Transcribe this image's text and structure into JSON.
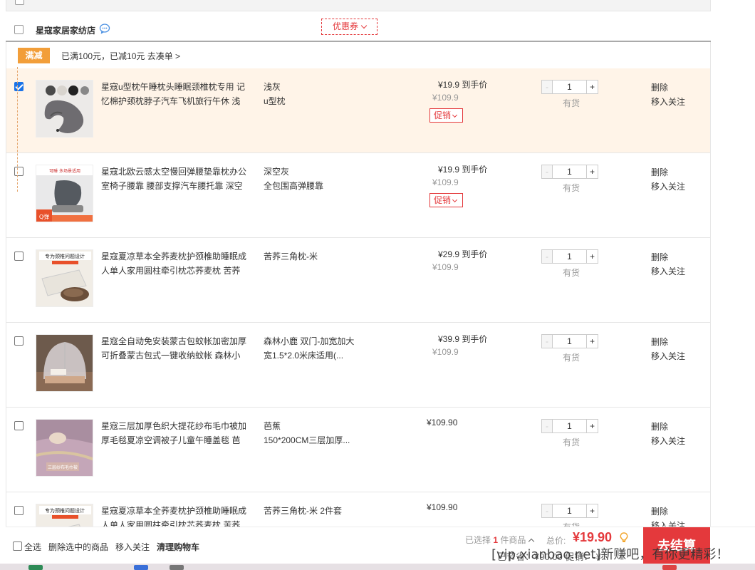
{
  "shop": {
    "name": "星寇家居家纺店",
    "coupon_label": "优惠券"
  },
  "promo": {
    "tag": "满减",
    "text": "已满100元，已减10元 去凑单 >"
  },
  "items": [
    {
      "checked": true,
      "title": "星寇u型枕午睡枕头睡眠颈椎枕专用 记忆棉护颈枕脖子汽车飞机旅行午休 浅",
      "spec1": "浅灰",
      "spec2": "u型枕",
      "price": "¥19.9 到手价",
      "old_price": "¥109.9",
      "promo_label": "促销",
      "qty": "1",
      "stock": "有货",
      "delete": "删除",
      "favorite": "移入关注"
    },
    {
      "checked": false,
      "title": "星寇北欧云感太空慢回弹腰垫靠枕办公室椅子腰靠 腰部支撑汽车腰托靠 深空",
      "spec1": "深空灰",
      "spec2": "全包围高弹腰靠",
      "price": "¥19.9 到手价",
      "old_price": "¥109.9",
      "promo_label": "促销",
      "qty": "1",
      "stock": "有货",
      "delete": "删除",
      "favorite": "移入关注"
    },
    {
      "checked": false,
      "title": "星寇夏凉草本全荞麦枕护颈椎助睡眠成人单人家用圆柱牵引枕芯荞麦枕 苦荞",
      "spec1": "苦荞三角枕-米",
      "spec2": "",
      "price": "¥29.9 到手价",
      "old_price": "¥109.9",
      "qty": "1",
      "stock": "有货",
      "delete": "删除",
      "favorite": "移入关注"
    },
    {
      "checked": false,
      "title": "星寇全自动免安装蒙古包蚊帐加密加厚可折叠蒙古包式一键收纳蚊帐 森林小",
      "spec1": "森林小鹿 双门-加宽加大",
      "spec2": "宽1.5*2.0米床适用(...",
      "price": "¥39.9 到手价",
      "old_price": "¥109.9",
      "qty": "1",
      "stock": "有货",
      "delete": "删除",
      "favorite": "移入关注"
    },
    {
      "checked": false,
      "title": "星寇三层加厚色织大提花纱布毛巾被加厚毛毯夏凉空调被子儿童午睡盖毯 芭",
      "spec1": "芭蕉",
      "spec2": "150*200CM三层加厚...",
      "price": "¥109.90",
      "qty": "1",
      "stock": "有货",
      "delete": "删除",
      "favorite": "移入关注"
    },
    {
      "checked": false,
      "title": "星寇夏凉草本全荞麦枕护颈椎助睡眠成人单人家用圆柱牵引枕芯荞麦枕 苦荞",
      "spec1": "苦荞三角枕-米 2件套",
      "spec2": "",
      "price": "¥109.90",
      "qty": "1",
      "stock": "有货",
      "delete": "删除",
      "favorite": "移入关注"
    }
  ],
  "thumb_texts": {
    "item2_badge": "Q弹",
    "item2_banner": "可睡 多场景适用",
    "item3_banner": "专为颈椎问题设计",
    "item5_banner": "三层纱布毛巾被",
    "item6_banner": "专为颈椎问题设计"
  },
  "bottom": {
    "select_all": "全选",
    "delete_selected": "删除选中的商品",
    "move_to_favorites": "移入关注",
    "clear_cart": "清理购物车",
    "selected_prefix": "已选择",
    "selected_count": "1",
    "selected_suffix": "件商品",
    "total_label": "总价:",
    "total_value": "¥19.90",
    "checkout": "去结算",
    "sub_text": "已节省：¥90.00 促销：-¥..."
  },
  "watermark": "[vip.xianbao.net]新赚吧，有你更精彩！",
  "colors": {
    "accent_red": "#e4393c",
    "promo_orange": "#f29e39",
    "selected_row_bg": "#fff4e8"
  }
}
